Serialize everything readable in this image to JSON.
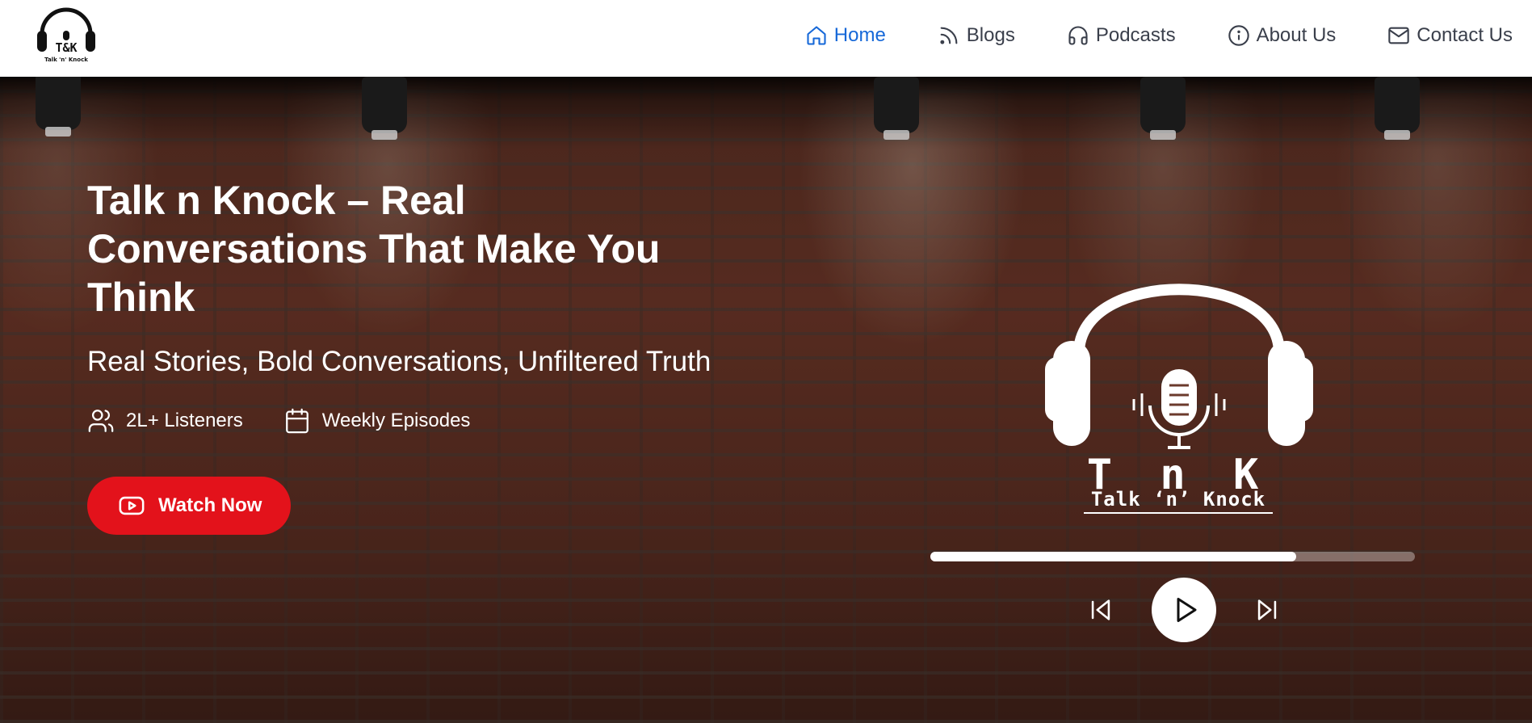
{
  "header": {
    "logo": {
      "name": "talk-n-knock-logo",
      "text_top": "T&K",
      "text_bottom": "Talk 'n' Knock"
    },
    "nav": [
      {
        "label": "Home",
        "icon": "home-icon",
        "active": true
      },
      {
        "label": "Blogs",
        "icon": "rss-icon",
        "active": false
      },
      {
        "label": "Podcasts",
        "icon": "headphones-icon",
        "active": false
      },
      {
        "label": "About Us",
        "icon": "info-icon",
        "active": false
      },
      {
        "label": "Contact Us",
        "icon": "mail-icon",
        "active": false
      }
    ],
    "accent_color": "#1668d8"
  },
  "hero": {
    "title": "Talk n Knock – Real Conversations That Make You Think",
    "subtitle": "Real Stories, Bold Conversations, Unfiltered Truth",
    "stats": [
      {
        "label": "2L+ Listeners",
        "icon": "users-icon"
      },
      {
        "label": "Weekly Episodes",
        "icon": "calendar-icon"
      }
    ],
    "cta": {
      "label": "Watch Now",
      "icon": "youtube-icon",
      "color": "#e3121b"
    }
  },
  "player": {
    "brand_letters": "T n K",
    "brand_caption": "Talk ‘n’ Knock",
    "progress": 0.755,
    "controls": [
      "skip-back-icon",
      "play-icon",
      "skip-forward-icon"
    ]
  }
}
